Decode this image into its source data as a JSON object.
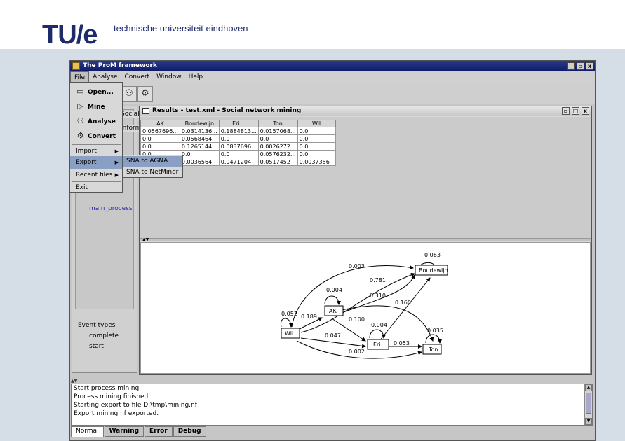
{
  "slide": {
    "logo_mark": "TU/e",
    "logo_text": "technische universiteit eindhoven"
  },
  "window": {
    "title": "The ProM framework",
    "controls": [
      "_",
      "▫",
      "x"
    ]
  },
  "menubar": [
    "File",
    "Analyse",
    "Convert",
    "Window",
    "Help"
  ],
  "file_menu": {
    "items": [
      {
        "icon": "open-icon",
        "label": "Open..."
      },
      {
        "icon": "mine-icon",
        "label": "Mine"
      },
      {
        "icon": "analyse-icon",
        "label": "Analyse"
      },
      {
        "icon": "convert-icon",
        "label": "Convert"
      }
    ],
    "import_label": "Import",
    "export_label": "Export",
    "recent_label": "Recent files",
    "exit_label": "Exit"
  },
  "export_submenu": [
    "SNA to AGNA",
    "SNA to NetMiner"
  ],
  "navigator": {
    "partial_social": "Social n",
    "partial_inform": "Informa",
    "process": "main_process",
    "event_types_label": "Event types",
    "event_types": [
      "complete",
      "start"
    ]
  },
  "results": {
    "title": "Results - test.xml - Social network mining",
    "columns": [
      "AK",
      "Boudewijn",
      "Eri...",
      "Ton",
      "Wil"
    ],
    "rows": [
      [
        "0.0567696...",
        "0.0314136...",
        "0.1884813...",
        "0.0157068...",
        "0.0"
      ],
      [
        "0.0",
        "0.0568464",
        "0.0",
        "0.0",
        "0.0"
      ],
      [
        "0.0",
        "0.1265144...",
        "0.0837696...",
        "0.0026272...",
        "0.0"
      ],
      [
        "0.0",
        "0.0",
        "0.0",
        "0.0576232...",
        "0.0"
      ],
      [
        "",
        "0.0036564",
        "0.0471204",
        "0.0517452",
        "0.0037356"
      ]
    ]
  },
  "graph": {
    "nodes": [
      "Boudewijn",
      "AK",
      "Wil",
      "Eri",
      "Ton"
    ],
    "self_loop_labels": {
      "Boudewijn": "0.063",
      "AK": "0.004",
      "Wil": "0.052",
      "Eri": "0.004",
      "Ton": "0.035"
    },
    "edge_labels": [
      "0.003",
      "0.781",
      "0.310",
      "0.160",
      "0.189",
      "0.100",
      "0.047",
      "0.053",
      "0.002"
    ]
  },
  "log": {
    "lines": [
      "Start process mining",
      "Process mining finished.",
      "Starting export to file D:\\tmp\\mining.nf",
      "Export mining nf exported."
    ]
  },
  "log_tabs": [
    "Normal",
    "Warning",
    "Error",
    "Debug"
  ]
}
